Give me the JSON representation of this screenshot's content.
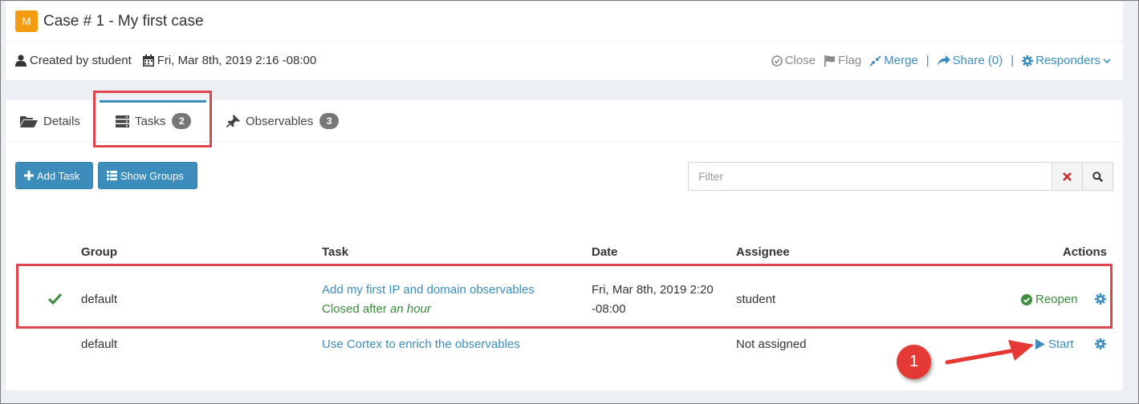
{
  "case": {
    "logo_letter": "M",
    "title": "Case # 1 - My first case",
    "created_by": "Created by student",
    "date": "Fri, Mar 8th, 2019 2:16 -08:00",
    "actions": {
      "close": "Close",
      "flag": "Flag",
      "merge": "Merge",
      "share": "Share (0)",
      "responders": "Responders"
    },
    "separator": "|"
  },
  "tabs": [
    {
      "label": "Details"
    },
    {
      "label": "Tasks",
      "count": "2"
    },
    {
      "label": "Observables",
      "count": "3"
    }
  ],
  "toolbar": {
    "add_task": "Add Task",
    "show_groups": "Show Groups",
    "filter_placeholder": "Filter"
  },
  "table": {
    "headers": {
      "group": "Group",
      "task": "Task",
      "date": "Date",
      "assignee": "Assignee",
      "actions": "Actions"
    },
    "rows": [
      {
        "status_icon": "check-icon",
        "group": "default",
        "task": "Add my first IP and domain observables",
        "note_prefix": "Closed after",
        "note_emphasis": "an hour",
        "date_line1": "Fri, Mar 8th, 2019 2:20",
        "date_line2": "-08:00",
        "assignee": "student",
        "action": "Reopen"
      },
      {
        "status_icon": "",
        "group": "default",
        "task": "Use Cortex to enrich the observables",
        "note_prefix": "",
        "note_emphasis": "",
        "date_line1": "",
        "date_line2": "",
        "assignee": "Not assigned",
        "action": "Start"
      }
    ]
  },
  "annotation": {
    "number": "1"
  },
  "colors": {
    "accent": "#3c8dbc",
    "logo": "#f39c12",
    "success": "#3d8b3d",
    "highlight": "#e0444d"
  }
}
